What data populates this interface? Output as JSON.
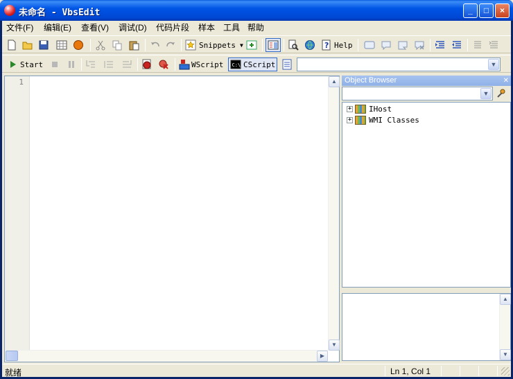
{
  "window": {
    "title": "未命名 - VbsEdit",
    "minimize": "_",
    "maximize": "□",
    "close": "×"
  },
  "menu": [
    "文件(F)",
    "编辑(E)",
    "查看(V)",
    "调试(D)",
    "代码片段",
    "样本",
    "工具",
    "帮助"
  ],
  "toolbar1": {
    "snippets_label": "Snippets",
    "help_label": "Help"
  },
  "toolbar2": {
    "start_label": "Start",
    "wscript_label": "WScript",
    "cscript_label": "CScript",
    "script_combo_value": ""
  },
  "editor": {
    "line_numbers": [
      "1"
    ]
  },
  "object_browser": {
    "title": "Object Browser",
    "combo_value": "",
    "tree": [
      "IHost",
      "WMI Classes"
    ]
  },
  "status": {
    "ready": "就绪",
    "position": "Ln 1, Col 1"
  },
  "colors": {
    "title_bar": "#0055E5",
    "close_button": "#C8431E",
    "panel_header": "#8FB1E8",
    "background": "#ECE9D8"
  }
}
